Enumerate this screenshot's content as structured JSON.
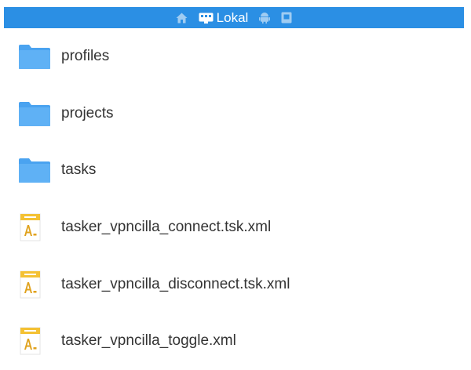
{
  "topbar": {
    "location_label": "Lokal",
    "icons": [
      "home-icon",
      "local-storage-icon",
      "android-icon",
      "sd-card-icon"
    ]
  },
  "files": [
    {
      "name": "profiles",
      "type": "folder",
      "icon": "folder-icon"
    },
    {
      "name": "projects",
      "type": "folder",
      "icon": "folder-icon"
    },
    {
      "name": "tasks",
      "type": "folder",
      "icon": "folder-icon"
    },
    {
      "name": "tasker_vpncilla_connect.tsk.xml",
      "type": "text-file",
      "icon": "txt-file-icon"
    },
    {
      "name": "tasker_vpncilla_disconnect.tsk.xml",
      "type": "text-file",
      "icon": "txt-file-icon"
    },
    {
      "name": "tasker_vpncilla_toggle.xml",
      "type": "text-file",
      "icon": "txt-file-icon"
    }
  ],
  "colors": {
    "topbar_bg": "#2b8fe4",
    "folder_blue": "#4aa3f0",
    "file_tag_yellow": "#f4c133"
  }
}
